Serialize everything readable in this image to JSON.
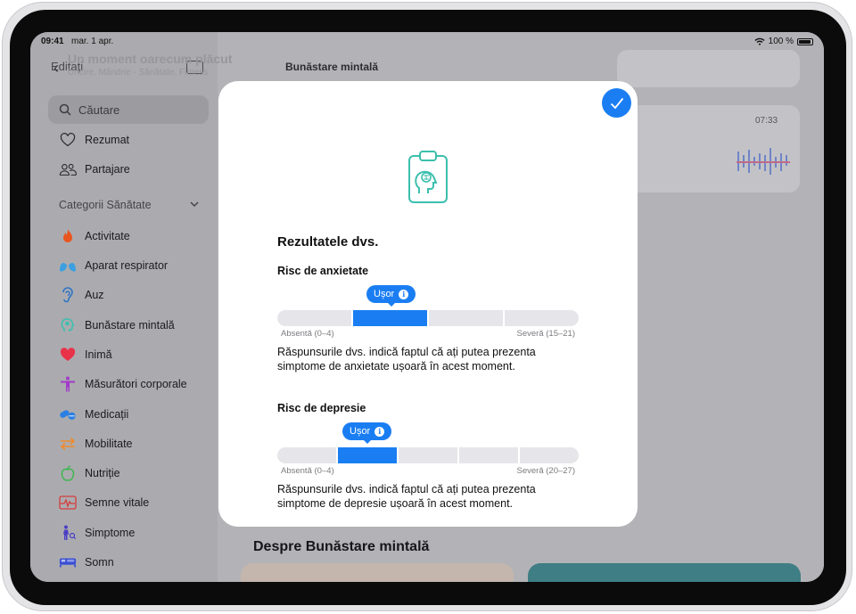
{
  "status": {
    "time": "09:41",
    "date": "mar. 1 apr.",
    "battery": "100 %"
  },
  "sidebar": {
    "edit_label": "Editați",
    "search_placeholder": "Căutare",
    "top_items": [
      {
        "label": "Rezumat",
        "icon": "heart-outline-icon"
      },
      {
        "label": "Partajare",
        "icon": "people-icon"
      }
    ],
    "section_title": "Categorii Sănătate",
    "categories": [
      {
        "label": "Activitate",
        "icon": "flame-icon",
        "color": "#e9541f"
      },
      {
        "label": "Aparat respirator",
        "icon": "lungs-icon",
        "color": "#3b9fe0"
      },
      {
        "label": "Auz",
        "icon": "ear-icon",
        "color": "#2f73c6"
      },
      {
        "label": "Bunăstare mintală",
        "icon": "mind-icon",
        "color": "#3cbfae"
      },
      {
        "label": "Inimă",
        "icon": "heart-icon",
        "color": "#e8324a"
      },
      {
        "label": "Măsurători corporale",
        "icon": "body-icon",
        "color": "#a23bc9"
      },
      {
        "label": "Medicații",
        "icon": "pills-icon",
        "color": "#2b7fe3"
      },
      {
        "label": "Mobilitate",
        "icon": "arrows-icon",
        "color": "#f08a2b"
      },
      {
        "label": "Nutriție",
        "icon": "apple-icon",
        "color": "#3db650"
      },
      {
        "label": "Semne vitale",
        "icon": "vitals-icon",
        "color": "#d63a3a"
      },
      {
        "label": "Simptome",
        "icon": "person-symptom-icon",
        "color": "#4b3fc4"
      },
      {
        "label": "Somn",
        "icon": "bed-icon",
        "color": "#3a4fd4"
      }
    ]
  },
  "background": {
    "nav_title": "Bunăstare mintală",
    "entry_title": "Un moment oarecum plăcut",
    "entry_subtitle": "Uricire, Mândrie - Sănătate, Fitness",
    "card_time": "07:33",
    "about_heading": "Despre Bunăstare mintală"
  },
  "modal": {
    "title": "Rezultatele dvs.",
    "colors": {
      "accent": "#1a7ef2",
      "track": "#e6e6ea",
      "clipboard": "#3cbfae"
    },
    "anxiety": {
      "label": "Risc de anxietate",
      "badge": "Ușor",
      "scale_min": "Absentă (0–4)",
      "scale_max": "Severă (15–21)",
      "segments": 4,
      "active_segment": 1,
      "description": "Răspunsurile dvs. indică faptul că ați putea prezenta simptome de anxietate ușoară în acest moment."
    },
    "depression": {
      "label": "Risc de depresie",
      "badge": "Ușor",
      "scale_min": "Absentă (0–4)",
      "scale_max": "Severă (20–27)",
      "segments": 5,
      "active_segment": 1,
      "description": "Răspunsurile dvs. indică faptul că ați putea prezenta simptome de depresie ușoară în acest moment."
    }
  }
}
